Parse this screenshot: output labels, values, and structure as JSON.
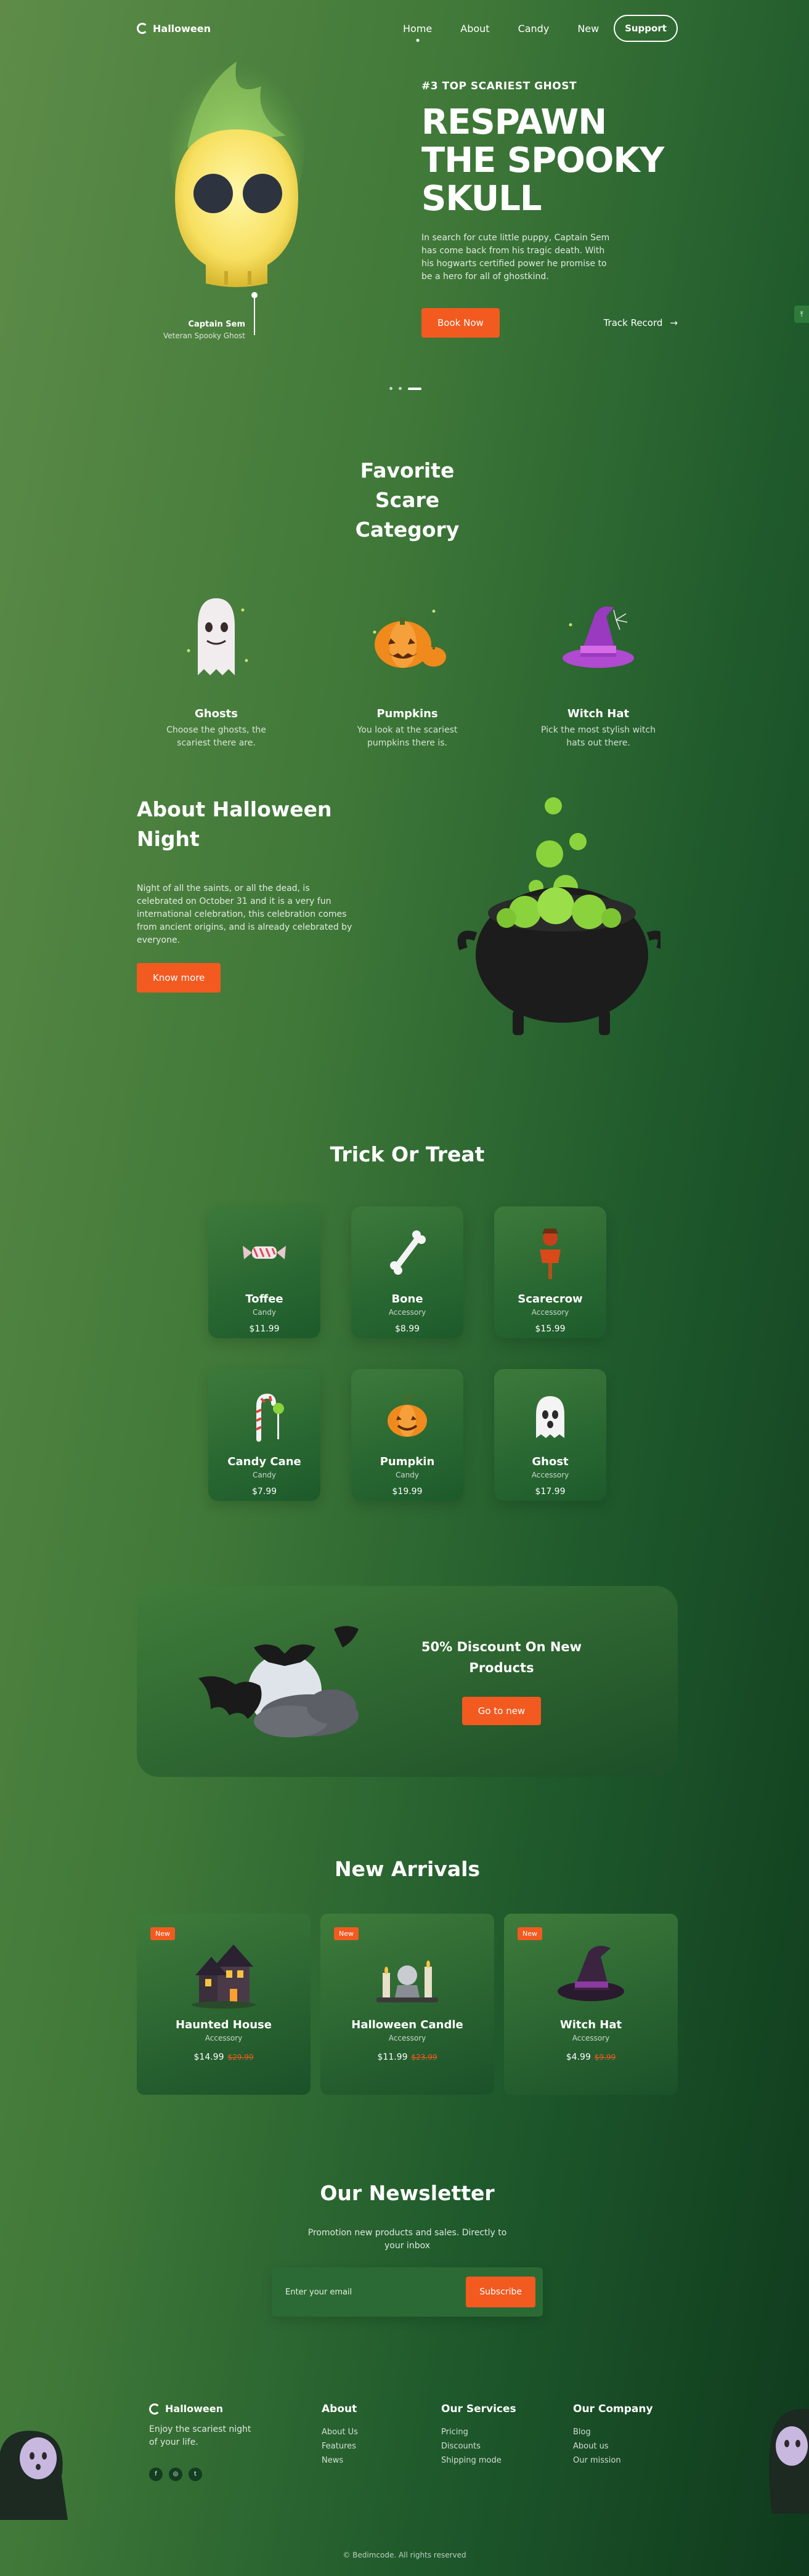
{
  "nav": {
    "brand": "Halloween",
    "links": [
      {
        "label": "Home"
      },
      {
        "label": "About"
      },
      {
        "label": "Candy"
      },
      {
        "label": "New"
      }
    ],
    "support_label": "Support"
  },
  "hero": {
    "eyebrow": "#3 TOP SCARIEST GHOST",
    "title_lines": [
      "RESPAWN",
      "THE SPOOKY",
      "SKULL"
    ],
    "lead": "In search for cute little puppy, Captain Sem has come back from his tragic death. With his hogwarts certified power he promise to be a hero for all of ghostkind.",
    "cta_label": "Book Now",
    "track_label": "Track Record",
    "caption_name": "Captain Sem",
    "caption_role": "Veteran Spooky Ghost"
  },
  "categories": {
    "title": "Favorite Scare Category",
    "items": [
      {
        "name": "Ghosts",
        "desc": "Choose the ghosts, the scariest there are."
      },
      {
        "name": "Pumpkins",
        "desc": "You look at the scariest pumpkins there is."
      },
      {
        "name": "Witch Hat",
        "desc": "Pick the most stylish witch hats out there."
      }
    ]
  },
  "about": {
    "title": "About Halloween Night",
    "desc": "Night of all the saints, or all the dead, is celebrated on October 31 and it is a very fun international celebration, this celebration comes from ancient origins, and is already celebrated by everyone.",
    "cta_label": "Know more"
  },
  "trick": {
    "title": "Trick Or Treat",
    "products": [
      {
        "name": "Toffee",
        "type": "Candy",
        "price": "$11.99"
      },
      {
        "name": "Bone",
        "type": "Accessory",
        "price": "$8.99"
      },
      {
        "name": "Scarecrow",
        "type": "Accessory",
        "price": "$15.99"
      },
      {
        "name": "Candy Cane",
        "type": "Candy",
        "price": "$7.99"
      },
      {
        "name": "Pumpkin",
        "type": "Candy",
        "price": "$19.99"
      },
      {
        "name": "Ghost",
        "type": "Accessory",
        "price": "$17.99"
      }
    ]
  },
  "discount": {
    "title": "50% Discount On New Products",
    "cta_label": "Go to new"
  },
  "arrivals": {
    "title": "New Arrivals",
    "badge": "New",
    "items": [
      {
        "name": "Haunted House",
        "type": "Accessory",
        "price": "$14.99",
        "old_price": "$29.99"
      },
      {
        "name": "Halloween Candle",
        "type": "Accessory",
        "price": "$11.99",
        "old_price": "$23.99"
      },
      {
        "name": "Witch Hat",
        "type": "Accessory",
        "price": "$4.99",
        "old_price": "$9.99"
      }
    ]
  },
  "newsletter": {
    "title": "Our Newsletter",
    "subtitle": "Promotion new products and sales. Directly to your inbox",
    "placeholder": "Enter your email",
    "cta_label": "Subscribe"
  },
  "footer": {
    "brand": "Halloween",
    "tagline": "Enjoy the scariest night of your life.",
    "socials": [
      "f",
      "◎",
      "t"
    ],
    "columns": [
      {
        "title": "About",
        "links": [
          "About Us",
          "Features",
          "News"
        ]
      },
      {
        "title": "Our Services",
        "links": [
          "Pricing",
          "Discounts",
          "Shipping mode"
        ]
      },
      {
        "title": "Our Company",
        "links": [
          "Blog",
          "About us",
          "Our mission"
        ]
      }
    ],
    "copyright": "© Bedimcode. All rights reserved"
  },
  "colors": {
    "accent": "#f25a20",
    "bg_light": "#5e8c48",
    "bg_dark": "#0f3a1d",
    "slime": "#8bd33c"
  }
}
